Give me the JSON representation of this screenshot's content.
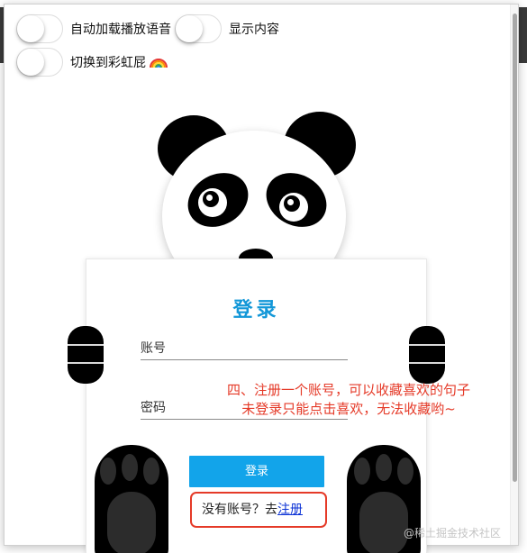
{
  "settings": {
    "toggles": [
      {
        "label": "自动加载播放语音",
        "on": false
      },
      {
        "label": "显示内容",
        "on": false
      },
      {
        "label": "切换到彩虹屁",
        "on": false,
        "icon": "rainbow-icon"
      }
    ]
  },
  "login": {
    "title": "登录",
    "username_label": "账号",
    "password_label": "密码",
    "submit_label": "登录",
    "no_account_text": "没有账号？去",
    "register_link": "注册"
  },
  "annotation": {
    "line1": "四、注册一个账号，可以收藏喜欢的句子",
    "line2": "未登录只能点击喜欢，无法收藏哟~"
  },
  "watermark": "@稀土掘金技术社区",
  "colors": {
    "accent_title": "#1297d8",
    "button": "#12a4ea",
    "link": "#0c33d6",
    "annotation": "#e53a28"
  }
}
